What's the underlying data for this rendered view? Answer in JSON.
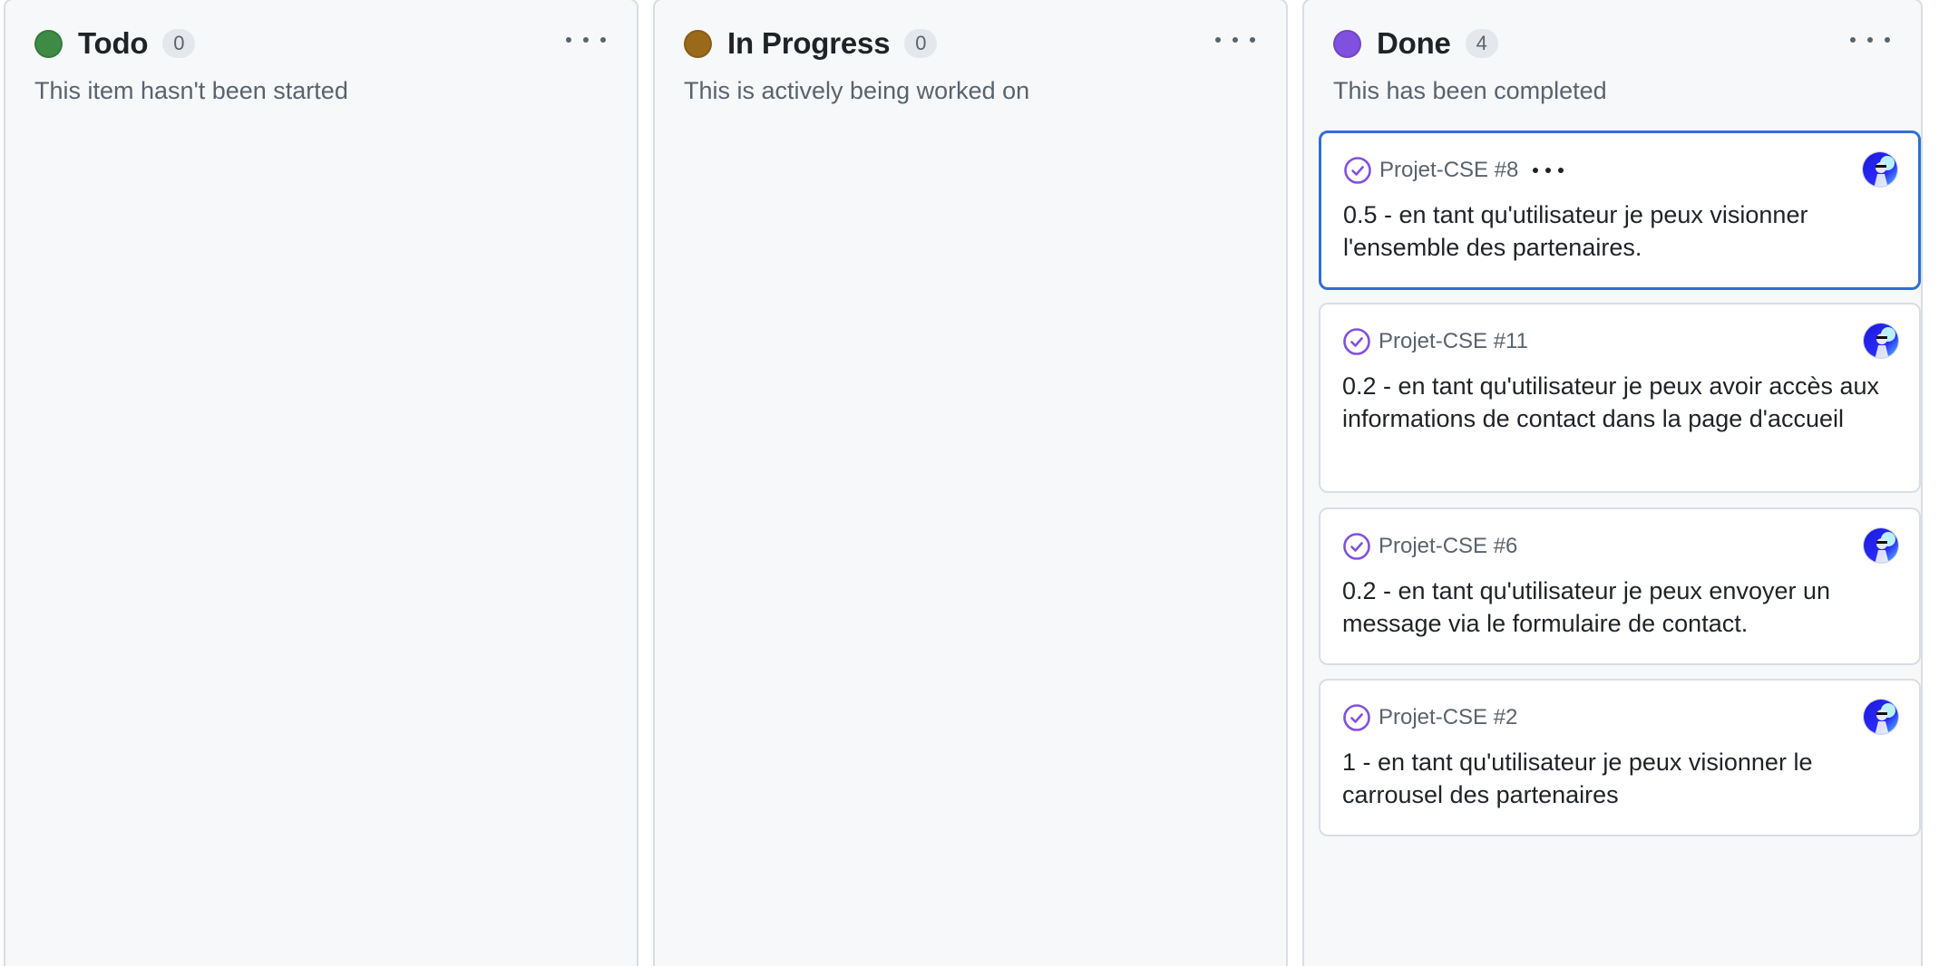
{
  "columns": [
    {
      "title": "Todo",
      "count": "0",
      "description": "This item hasn't been started",
      "color": "#3e8b45"
    },
    {
      "title": "In Progress",
      "count": "0",
      "description": "This is actively being worked on",
      "color": "#9a6a1a"
    },
    {
      "title": "Done",
      "count": "4",
      "description": "This has been completed",
      "color": "#8250df",
      "cards": [
        {
          "ref": "Projet-CSE #8",
          "title": "0.5 - en tant qu'utilisateur je peux visionner l'ensemble des partenaires.",
          "selected": true
        },
        {
          "ref": "Projet-CSE #11",
          "title": "0.2 - en tant qu'utilisateur je peux avoir accès aux informations de contact dans la page d'accueil"
        },
        {
          "ref": "Projet-CSE #6",
          "title": "0.2 - en tant qu'utilisateur je peux envoyer un message via le formulaire de contact."
        },
        {
          "ref": "Projet-CSE #2",
          "title": "1 - en tant qu'utilisateur je peux visionner le carrousel des partenaires"
        }
      ]
    }
  ],
  "icons": {
    "column_menu": "kebab-horizontal-icon",
    "card_status": "check-circle-icon",
    "card_menu": "kebab-horizontal-icon",
    "assignee": "avatar-image"
  },
  "colors": {
    "done_check": "#8250df",
    "selected_border": "#2f6fd6"
  }
}
